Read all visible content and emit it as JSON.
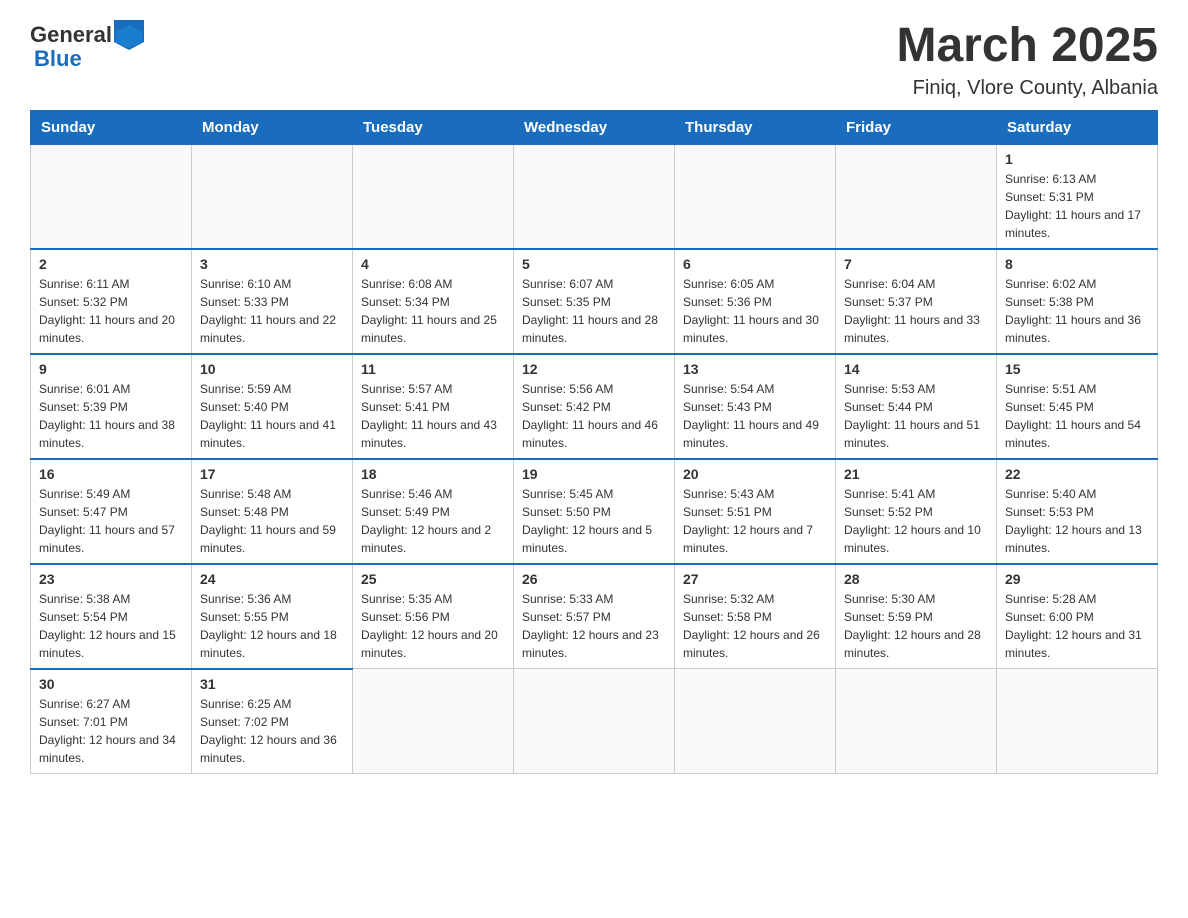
{
  "header": {
    "logo_general": "General",
    "logo_blue": "Blue",
    "main_title": "March 2025",
    "subtitle": "Finiq, Vlore County, Albania"
  },
  "calendar": {
    "weekdays": [
      "Sunday",
      "Monday",
      "Tuesday",
      "Wednesday",
      "Thursday",
      "Friday",
      "Saturday"
    ],
    "weeks": [
      [
        {
          "day": "",
          "info": ""
        },
        {
          "day": "",
          "info": ""
        },
        {
          "day": "",
          "info": ""
        },
        {
          "day": "",
          "info": ""
        },
        {
          "day": "",
          "info": ""
        },
        {
          "day": "",
          "info": ""
        },
        {
          "day": "1",
          "info": "Sunrise: 6:13 AM\nSunset: 5:31 PM\nDaylight: 11 hours and 17 minutes."
        }
      ],
      [
        {
          "day": "2",
          "info": "Sunrise: 6:11 AM\nSunset: 5:32 PM\nDaylight: 11 hours and 20 minutes."
        },
        {
          "day": "3",
          "info": "Sunrise: 6:10 AM\nSunset: 5:33 PM\nDaylight: 11 hours and 22 minutes."
        },
        {
          "day": "4",
          "info": "Sunrise: 6:08 AM\nSunset: 5:34 PM\nDaylight: 11 hours and 25 minutes."
        },
        {
          "day": "5",
          "info": "Sunrise: 6:07 AM\nSunset: 5:35 PM\nDaylight: 11 hours and 28 minutes."
        },
        {
          "day": "6",
          "info": "Sunrise: 6:05 AM\nSunset: 5:36 PM\nDaylight: 11 hours and 30 minutes."
        },
        {
          "day": "7",
          "info": "Sunrise: 6:04 AM\nSunset: 5:37 PM\nDaylight: 11 hours and 33 minutes."
        },
        {
          "day": "8",
          "info": "Sunrise: 6:02 AM\nSunset: 5:38 PM\nDaylight: 11 hours and 36 minutes."
        }
      ],
      [
        {
          "day": "9",
          "info": "Sunrise: 6:01 AM\nSunset: 5:39 PM\nDaylight: 11 hours and 38 minutes."
        },
        {
          "day": "10",
          "info": "Sunrise: 5:59 AM\nSunset: 5:40 PM\nDaylight: 11 hours and 41 minutes."
        },
        {
          "day": "11",
          "info": "Sunrise: 5:57 AM\nSunset: 5:41 PM\nDaylight: 11 hours and 43 minutes."
        },
        {
          "day": "12",
          "info": "Sunrise: 5:56 AM\nSunset: 5:42 PM\nDaylight: 11 hours and 46 minutes."
        },
        {
          "day": "13",
          "info": "Sunrise: 5:54 AM\nSunset: 5:43 PM\nDaylight: 11 hours and 49 minutes."
        },
        {
          "day": "14",
          "info": "Sunrise: 5:53 AM\nSunset: 5:44 PM\nDaylight: 11 hours and 51 minutes."
        },
        {
          "day": "15",
          "info": "Sunrise: 5:51 AM\nSunset: 5:45 PM\nDaylight: 11 hours and 54 minutes."
        }
      ],
      [
        {
          "day": "16",
          "info": "Sunrise: 5:49 AM\nSunset: 5:47 PM\nDaylight: 11 hours and 57 minutes."
        },
        {
          "day": "17",
          "info": "Sunrise: 5:48 AM\nSunset: 5:48 PM\nDaylight: 11 hours and 59 minutes."
        },
        {
          "day": "18",
          "info": "Sunrise: 5:46 AM\nSunset: 5:49 PM\nDaylight: 12 hours and 2 minutes."
        },
        {
          "day": "19",
          "info": "Sunrise: 5:45 AM\nSunset: 5:50 PM\nDaylight: 12 hours and 5 minutes."
        },
        {
          "day": "20",
          "info": "Sunrise: 5:43 AM\nSunset: 5:51 PM\nDaylight: 12 hours and 7 minutes."
        },
        {
          "day": "21",
          "info": "Sunrise: 5:41 AM\nSunset: 5:52 PM\nDaylight: 12 hours and 10 minutes."
        },
        {
          "day": "22",
          "info": "Sunrise: 5:40 AM\nSunset: 5:53 PM\nDaylight: 12 hours and 13 minutes."
        }
      ],
      [
        {
          "day": "23",
          "info": "Sunrise: 5:38 AM\nSunset: 5:54 PM\nDaylight: 12 hours and 15 minutes."
        },
        {
          "day": "24",
          "info": "Sunrise: 5:36 AM\nSunset: 5:55 PM\nDaylight: 12 hours and 18 minutes."
        },
        {
          "day": "25",
          "info": "Sunrise: 5:35 AM\nSunset: 5:56 PM\nDaylight: 12 hours and 20 minutes."
        },
        {
          "day": "26",
          "info": "Sunrise: 5:33 AM\nSunset: 5:57 PM\nDaylight: 12 hours and 23 minutes."
        },
        {
          "day": "27",
          "info": "Sunrise: 5:32 AM\nSunset: 5:58 PM\nDaylight: 12 hours and 26 minutes."
        },
        {
          "day": "28",
          "info": "Sunrise: 5:30 AM\nSunset: 5:59 PM\nDaylight: 12 hours and 28 minutes."
        },
        {
          "day": "29",
          "info": "Sunrise: 5:28 AM\nSunset: 6:00 PM\nDaylight: 12 hours and 31 minutes."
        }
      ],
      [
        {
          "day": "30",
          "info": "Sunrise: 6:27 AM\nSunset: 7:01 PM\nDaylight: 12 hours and 34 minutes."
        },
        {
          "day": "31",
          "info": "Sunrise: 6:25 AM\nSunset: 7:02 PM\nDaylight: 12 hours and 36 minutes."
        },
        {
          "day": "",
          "info": ""
        },
        {
          "day": "",
          "info": ""
        },
        {
          "day": "",
          "info": ""
        },
        {
          "day": "",
          "info": ""
        },
        {
          "day": "",
          "info": ""
        }
      ]
    ]
  }
}
